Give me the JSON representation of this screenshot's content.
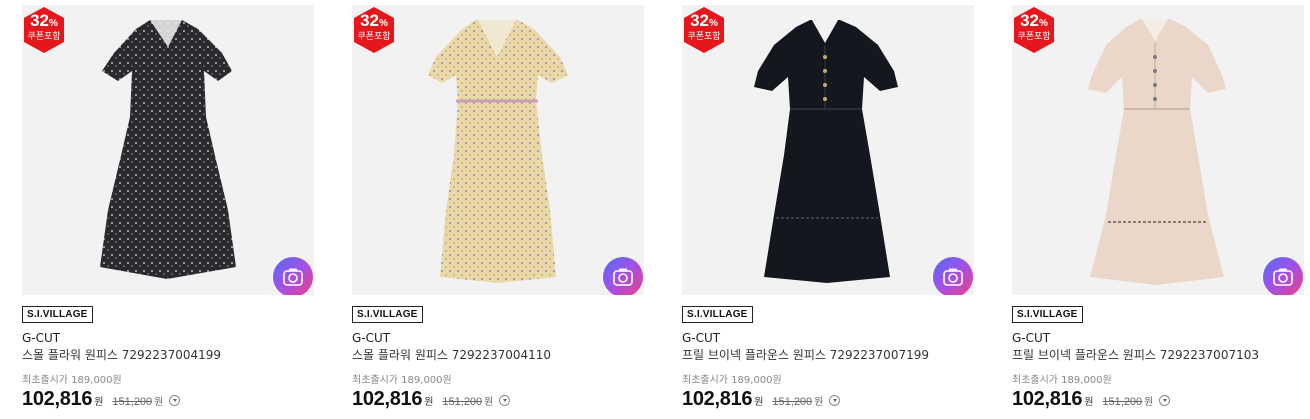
{
  "colors": {
    "badge_red": "#e5161c",
    "camera_gradient": [
      "#4f6cf7",
      "#a64fe6",
      "#ef3f7f"
    ]
  },
  "products": [
    {
      "badge": {
        "percent": "32",
        "percent_sign": "%",
        "label": "쿠폰포함"
      },
      "image_icon": "dress-floral-black-image",
      "dress_color": "#2a2a2e",
      "brand_tag": "S.I.VILLAGE",
      "brand": "G-CUT",
      "name": "스몰 플라워 원피스 7292237004199",
      "original_price": "최초출시가 189,000원",
      "price": "102,816",
      "currency": "원",
      "strike_price": "151,200",
      "strike_currency": "원"
    },
    {
      "badge": {
        "percent": "32",
        "percent_sign": "%",
        "label": "쿠폰포함"
      },
      "image_icon": "dress-floral-beige-image",
      "dress_color": "#e9d7a6",
      "brand_tag": "S.I.VILLAGE",
      "brand": "G-CUT",
      "name": "스몰 플라워 원피스 7292237004110",
      "original_price": "최초출시가 189,000원",
      "price": "102,816",
      "currency": "원",
      "strike_price": "151,200",
      "strike_currency": "원"
    },
    {
      "badge": {
        "percent": "32",
        "percent_sign": "%",
        "label": "쿠폰포함"
      },
      "image_icon": "dress-navy-image",
      "dress_color": "#14161f",
      "brand_tag": "S.I.VILLAGE",
      "brand": "G-CUT",
      "name": "프릴 브이넥 플라운스 원피스 7292237007199",
      "original_price": "최초출시가 189,000원",
      "price": "102,816",
      "currency": "원",
      "strike_price": "151,200",
      "strike_currency": "원"
    },
    {
      "badge": {
        "percent": "32",
        "percent_sign": "%",
        "label": "쿠폰포함"
      },
      "image_icon": "dress-pink-beige-image",
      "dress_color": "#ead6c8",
      "brand_tag": "S.I.VILLAGE",
      "brand": "G-CUT",
      "name": "프릴 브이넥 플라운스 원피스 7292237007103",
      "original_price": "최초출시가 189,000원",
      "price": "102,816",
      "currency": "원",
      "strike_price": "151,200",
      "strike_currency": "원"
    }
  ]
}
